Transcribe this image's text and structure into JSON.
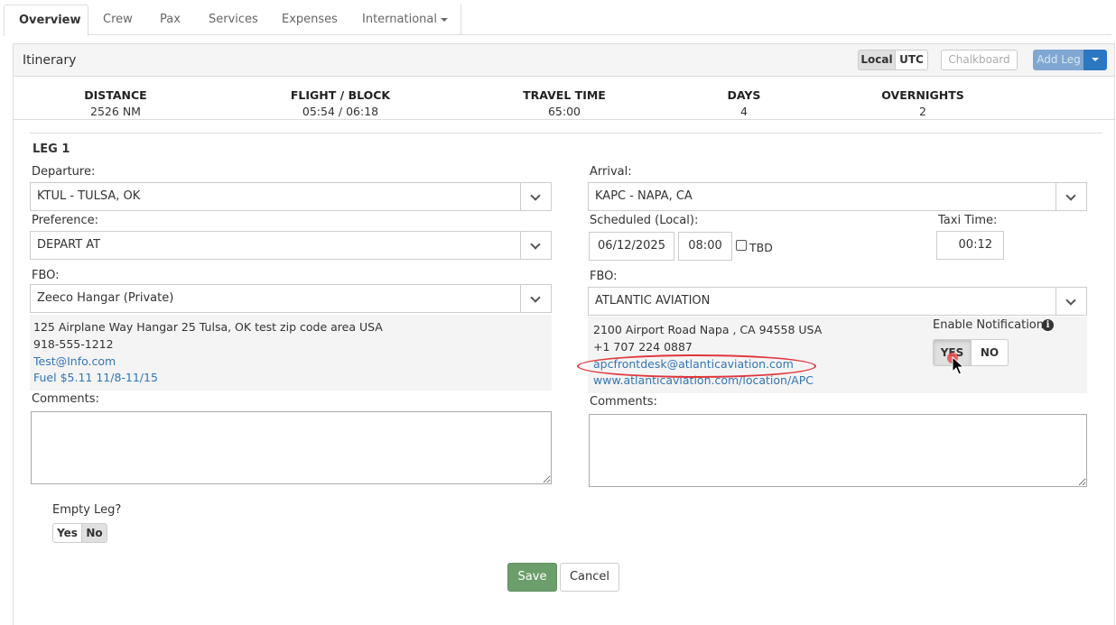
{
  "tabs": [
    {
      "label": "Overview",
      "active": true
    },
    {
      "label": "Crew"
    },
    {
      "label": "Pax"
    },
    {
      "label": "Services"
    },
    {
      "label": "Expenses"
    },
    {
      "label": "International"
    }
  ],
  "itinerary": {
    "title": "Itinerary",
    "local_label": "Local",
    "utc_label": "UTC",
    "chalkboard_label": "Chalkboard",
    "add_leg_label": "Add Leg"
  },
  "stats": [
    {
      "label": "DISTANCE",
      "value": "2526 NM"
    },
    {
      "label": "FLIGHT / BLOCK",
      "value": "05:54 / 06:18"
    },
    {
      "label": "TRAVEL TIME",
      "value": "65:00"
    },
    {
      "label": "DAYS",
      "value": "4"
    },
    {
      "label": "OVERNIGHTS",
      "value": "2"
    }
  ],
  "leg": {
    "title": "LEG 1",
    "departure": {
      "label": "Departure:",
      "value": "KTUL - TULSA, OK",
      "preference_label": "Preference:",
      "preference_value": "DEPART AT",
      "fbo_label": "FBO:",
      "fbo_value": "Zeeco Hangar (Private)",
      "fbo_address": "125 Airplane Way Hangar 25 Tulsa, OK test zip code area USA",
      "fbo_phone": "918-555-1212",
      "fbo_email": "Test@Info.com",
      "fbo_fuel": "Fuel $5.11 11/8-11/15",
      "comments_label": "Comments:"
    },
    "arrival": {
      "label": "Arrival:",
      "value": "KAPC - NAPA, CA",
      "scheduled_label": "Scheduled (Local):",
      "date": "06/12/2025",
      "time": "08:00",
      "tbd_label": "TBD",
      "taxi_label": "Taxi Time:",
      "taxi_value": "00:12",
      "fbo_label": "FBO:",
      "fbo_value": "ATLANTIC AVIATION",
      "fbo_address": "2100 Airport Road  Napa , CA  94558  USA",
      "fbo_phone": "+1 707 224 0887",
      "fbo_email": "apcfrontdesk@atlanticaviation.com",
      "fbo_website": "www.atlanticaviation.com/location/APC",
      "notification_label": "Enable Notification",
      "yes_label": "YES",
      "no_label": "NO",
      "comments_label": "Comments:"
    },
    "empty_leg": {
      "label": "Empty Leg?",
      "yes": "Yes",
      "no": "No"
    }
  },
  "actions": {
    "save": "Save",
    "cancel": "Cancel"
  },
  "colors": {
    "save_green": "#6b9e6b",
    "link_blue": "#3375b6",
    "highlight_red": "#e0353b",
    "add_leg_blue": "#7fa7d1"
  }
}
